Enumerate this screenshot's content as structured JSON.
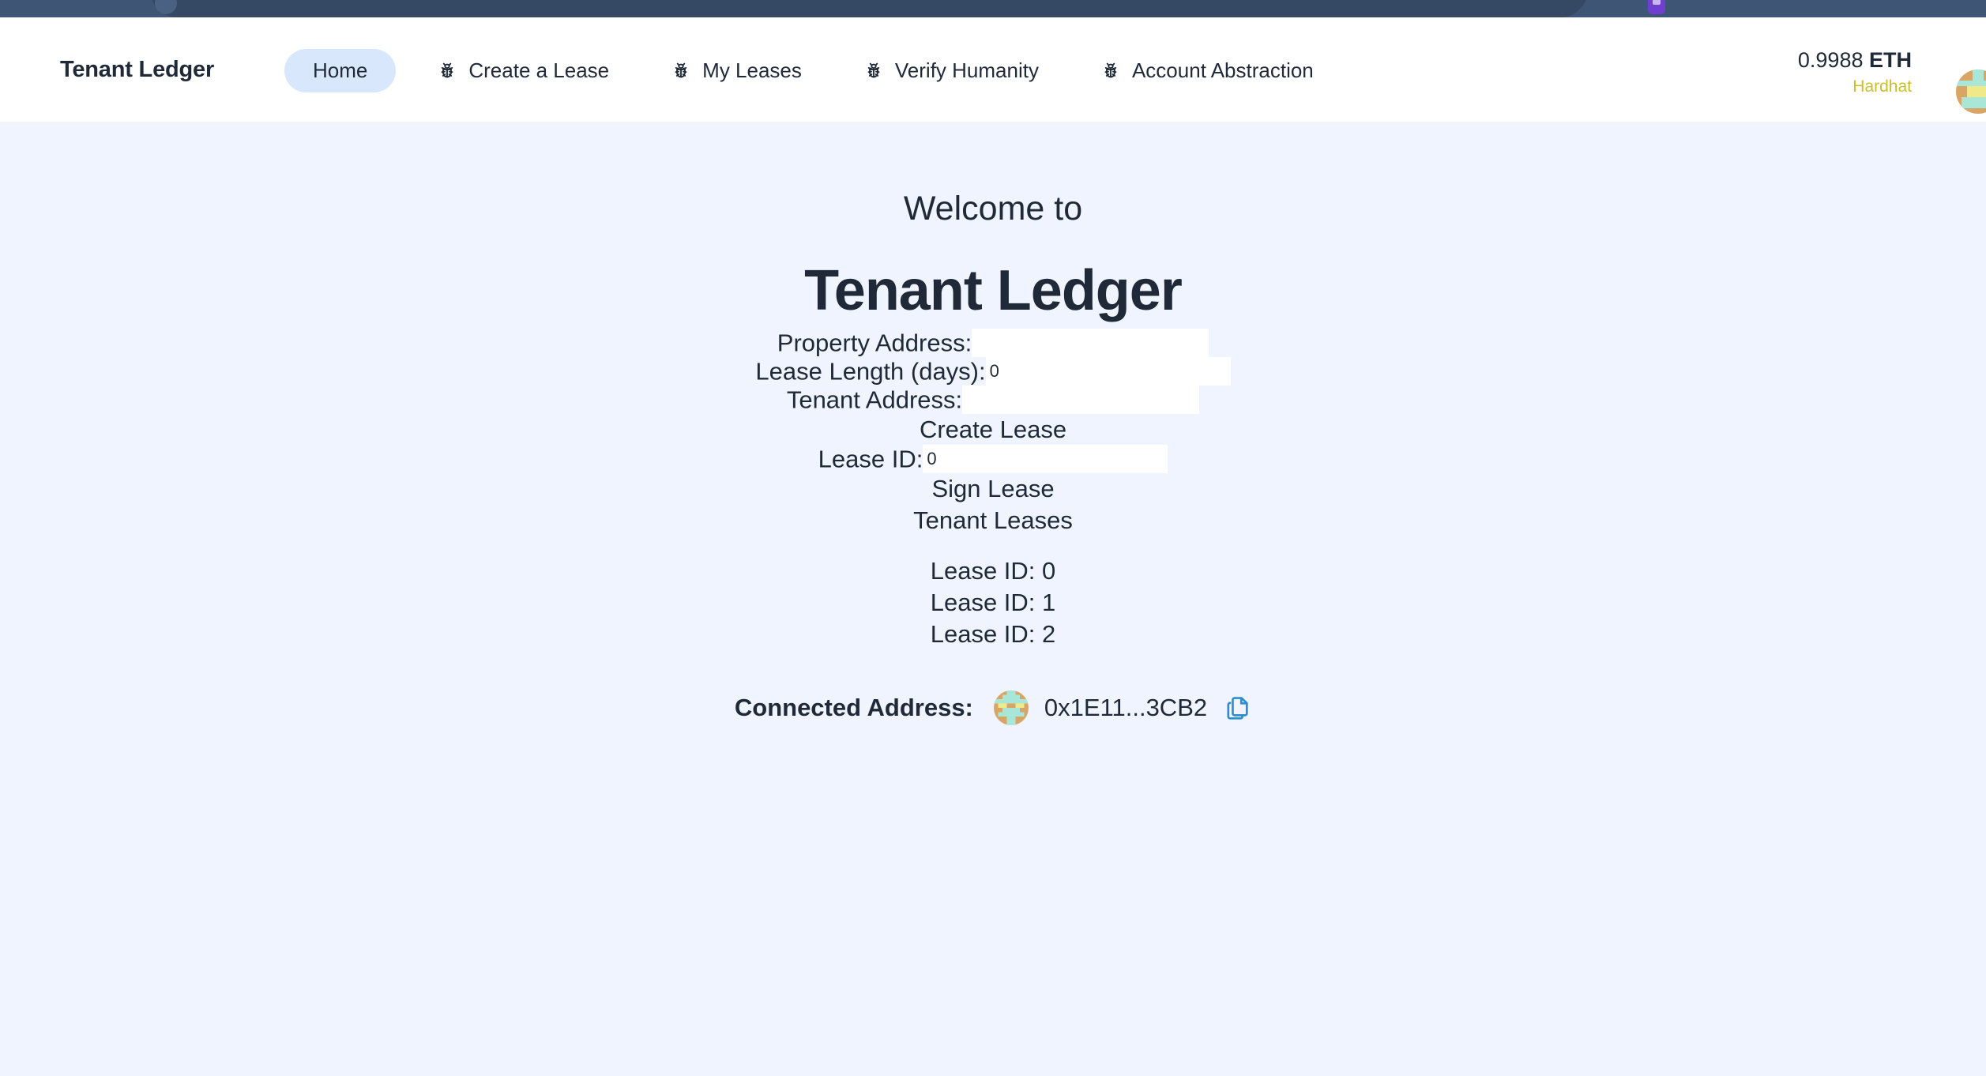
{
  "browser": {
    "omnibox_placeholder": "",
    "extension_icon": "wallet-extension-icon"
  },
  "header": {
    "brand": "Tenant Ledger",
    "nav": [
      {
        "label": "Home",
        "icon": "bug-icon",
        "has_icon": false,
        "active": true
      },
      {
        "label": "Create a Lease",
        "icon": "bug-icon",
        "has_icon": true,
        "active": false
      },
      {
        "label": "My Leases",
        "icon": "bug-icon",
        "has_icon": true,
        "active": false
      },
      {
        "label": "Verify Humanity",
        "icon": "bug-icon",
        "has_icon": true,
        "active": false
      },
      {
        "label": "Account Abstraction",
        "icon": "bug-icon",
        "has_icon": true,
        "active": false
      }
    ],
    "wallet": {
      "balance": "0.9988",
      "balance_unit": "ETH",
      "network": "Hardhat",
      "network_color": "#cbbf2c",
      "avatar": "user-blockie-avatar"
    }
  },
  "main": {
    "welcome_line": "Welcome to",
    "app_title": "Tenant Ledger",
    "form": {
      "property_address_label": "Property Address:",
      "property_address_value": "",
      "property_address_placeholder": "",
      "lease_length_label": "Lease Length (days):",
      "lease_length_value": "0",
      "tenant_address_label": "Tenant Address:",
      "tenant_address_value": "",
      "tenant_address_placeholder": "",
      "create_lease_button": "Create Lease",
      "lease_id_label": "Lease ID:",
      "lease_id_value": "0",
      "sign_lease_button": "Sign Lease"
    },
    "leases_heading": "Tenant Leases",
    "leases": [
      "Lease ID: 0",
      "Lease ID: 1",
      "Lease ID: 2"
    ],
    "connected": {
      "label": "Connected Address:",
      "address": "0x1E11...3CB2",
      "copy_icon": "copy-icon",
      "copy_icon_color": "#2d8fd0",
      "blockie": "address-blockie-avatar"
    }
  },
  "colors": {
    "page_bg": "#eff4fe",
    "header_bg": "#ffffff",
    "text": "#1f2937",
    "active_pill": "#d9e7fd",
    "chrome_bg": "#3f5575"
  }
}
